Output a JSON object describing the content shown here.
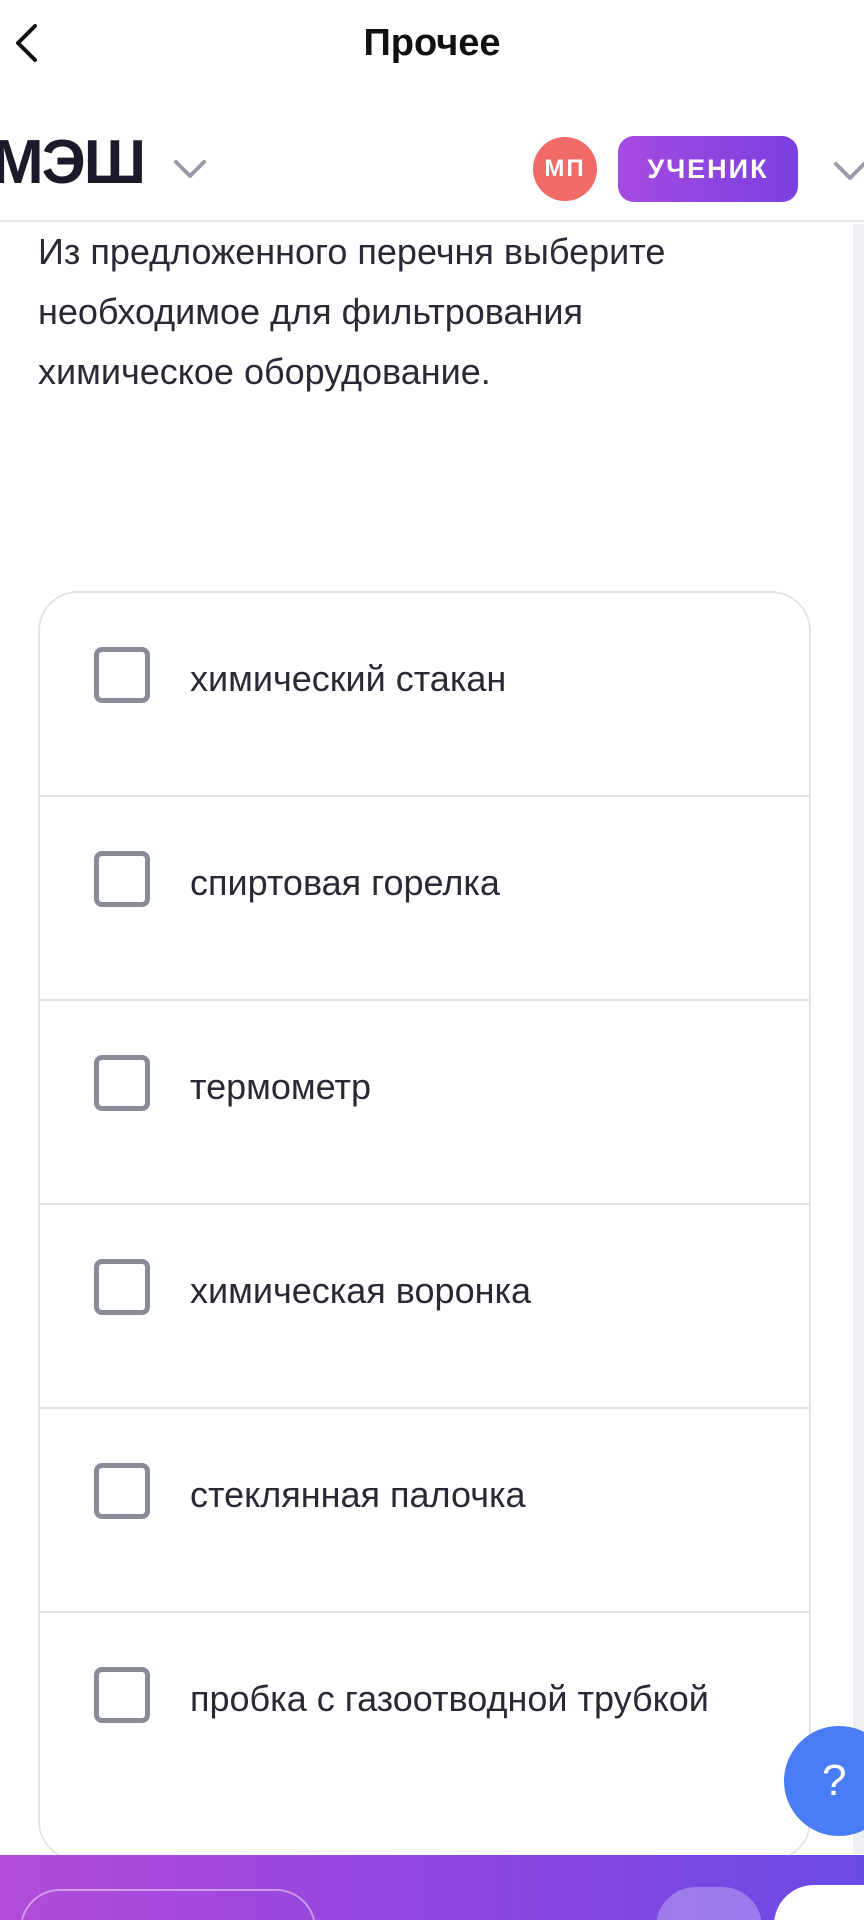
{
  "topbar": {
    "title": "Прочее",
    "back_icon": "chevron-left-icon"
  },
  "header": {
    "logo_text": "МЭШ",
    "avatar_initials": "МП",
    "role_badge": "УЧЕНИК",
    "avatar_color": "#f06a68",
    "badge_gradient": [
      "#a64be0",
      "#7a3fe0"
    ]
  },
  "question": {
    "text": "Из предложенного перечня выберите необходимое для фильтрования химическое оборудование."
  },
  "options": [
    {
      "label": "химический стакан",
      "checked": false
    },
    {
      "label": "спиртовая горелка",
      "checked": false
    },
    {
      "label": "термометр",
      "checked": false
    },
    {
      "label": "химическая воронка",
      "checked": false
    },
    {
      "label": "стеклянная палочка",
      "checked": false
    },
    {
      "label": "пробка с газоотводной трубкой",
      "checked": false
    }
  ],
  "help_button": {
    "label": "?",
    "color": "#4a7cf5"
  },
  "bottom_bar": {
    "gradient": [
      "#b24ad8",
      "#6a4ae6"
    ]
  }
}
